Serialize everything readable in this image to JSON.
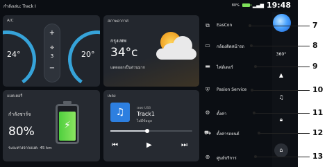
{
  "status": {
    "left": "กำลังเล่น: Track I",
    "battery_pct": "80%",
    "time": "19:48"
  },
  "ac": {
    "title": "A/C",
    "left_temp": "24°",
    "right_temp": "20°",
    "plus": "+",
    "minus": "−",
    "fan_level": "3",
    "fan_icon": "fan-icon"
  },
  "weather": {
    "title": "สภาพอากาศ",
    "city": "กรุงเทพ",
    "temp": "34°c",
    "desc": "แดดออกเป็นส่วนมาก"
  },
  "battery": {
    "title": "แบตเตอรี่",
    "status": "กำลังชาร์จ",
    "percent": "80%",
    "range": "ระยะทางจากแบต: 45 km",
    "level": 0.8
  },
  "music": {
    "title": "เพลง",
    "source": "เพลง USB",
    "track": "Track1",
    "info": "ไม่มีข้อมูล",
    "progress": 0.45
  },
  "menu": {
    "items": [
      {
        "label": "EasCon",
        "icon": "screen-mirror-icon",
        "num": "7"
      },
      {
        "label": "กล้องติดหน้ารถ",
        "icon": "monitor-icon",
        "num": "8"
      },
      {
        "label": "ไฟล์เดอร์",
        "icon": "folder-icon",
        "num": "9"
      },
      {
        "label": "Pasion Service",
        "icon": "shield-icon",
        "num": "10"
      },
      {
        "label": "ตั้งค่า",
        "icon": "gear-icon",
        "num": "11"
      },
      {
        "label": "ตั้งค่ารถยนต์",
        "icon": "car-icon",
        "num": "12"
      },
      {
        "label": "ศูนย์บริการ",
        "icon": "plus-circle-icon",
        "num": "13"
      }
    ]
  },
  "sidebar": {
    "view360": "360°"
  },
  "colors": {
    "accent": "#36a3d9",
    "battery_green": "#6fd94e",
    "background": "#0b0e13",
    "card": "#262a31"
  }
}
